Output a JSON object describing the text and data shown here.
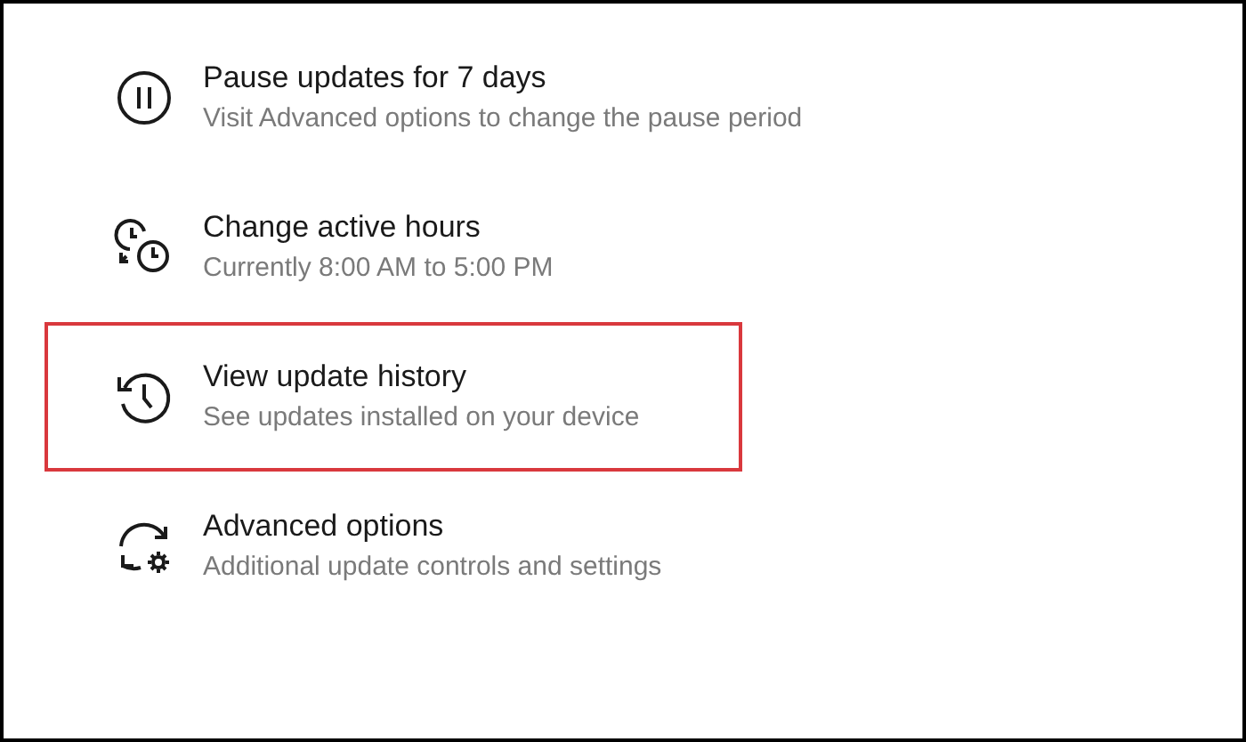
{
  "items": [
    {
      "kind": "pause",
      "title": "Pause updates for 7 days",
      "subtitle": "Visit Advanced options to change the pause period",
      "highlighted": false
    },
    {
      "kind": "hours",
      "title": "Change active hours",
      "subtitle": "Currently 8:00 AM to 5:00 PM",
      "highlighted": false
    },
    {
      "kind": "history",
      "title": "View update history",
      "subtitle": "See updates installed on your device",
      "highlighted": true
    },
    {
      "kind": "advanced",
      "title": "Advanced options",
      "subtitle": "Additional update controls and settings",
      "highlighted": false
    }
  ]
}
